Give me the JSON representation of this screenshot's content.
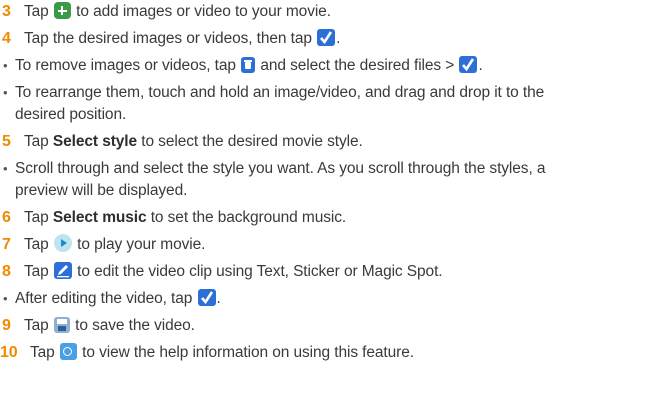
{
  "steps": {
    "s3": {
      "num": "3",
      "pre": "Tap",
      "post": "to add images or video to your movie.",
      "icon": "add-icon"
    },
    "s4": {
      "num": "4",
      "pre": "Tap the desired images or videos, then tap",
      "post": ".",
      "icon": "checkmark-icon"
    },
    "b1": {
      "pre": "To remove images or videos, tap",
      "mid": "and select the desired files >",
      "post": ".",
      "icon1": "delete-icon",
      "icon2": "checkmark-icon"
    },
    "b2": {
      "line1": "To rearrange them, touch and hold an image/video, and drag and drop it to the",
      "line2": "desired position."
    },
    "s5": {
      "num": "5",
      "pre": "Tap",
      "bold": "Select style",
      "post": "to select the desired movie style."
    },
    "b3": {
      "line1": "Scroll through and select the style you want. As you scroll through the styles, a",
      "line2": "preview will be displayed."
    },
    "s6": {
      "num": "6",
      "pre": "Tap",
      "bold": "Select music",
      "post": "to set the background music."
    },
    "s7": {
      "num": "7",
      "pre": "Tap",
      "post": "to play your movie.",
      "icon": "play-icon"
    },
    "s8": {
      "num": "8",
      "pre": "Tap",
      "post": "to edit the video clip using Text, Sticker or Magic Spot.",
      "icon": "edit-icon"
    },
    "b4": {
      "pre": "After editing the video, tap",
      "post": ".",
      "icon": "checkmark-icon"
    },
    "s9": {
      "num": "9",
      "pre": "Tap",
      "post": "to save the video.",
      "icon": "save-icon"
    },
    "s10": {
      "num": "10",
      "pre": "Tap",
      "post": "to view the help information on using this feature.",
      "icon": "help-icon"
    }
  },
  "colors": {
    "step_number": "#f08a00",
    "icon_blue": "#2c6fd6",
    "icon_green": "#3b9a45",
    "text": "#3a3a3a"
  }
}
